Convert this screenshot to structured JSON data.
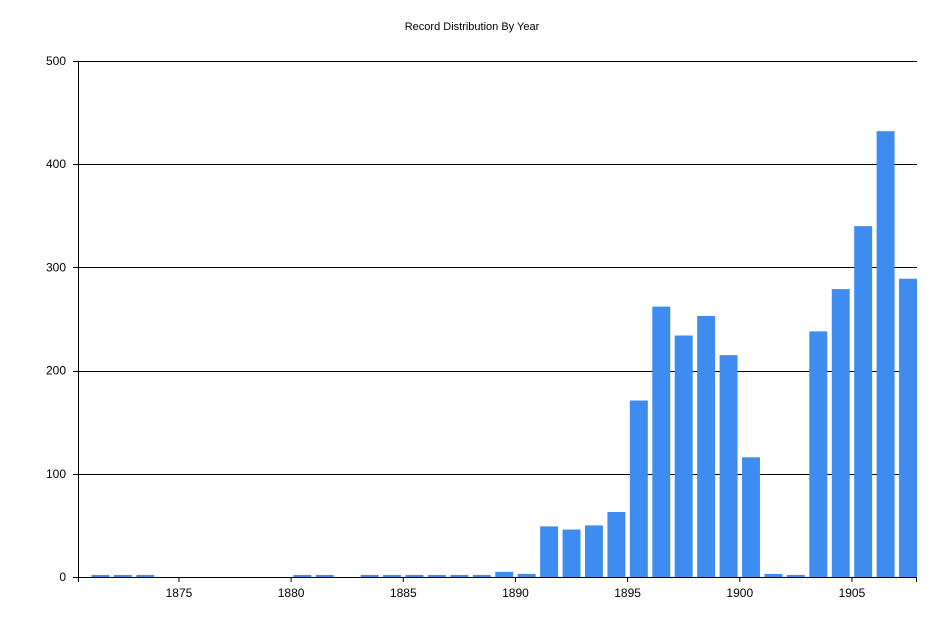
{
  "colors": {
    "bar": "#3f8cf0",
    "gridline": "#000000",
    "axis": "#000000",
    "text": "#000000",
    "background": "#ffffff"
  },
  "chart_data": {
    "type": "bar",
    "title": "Record Distribution By Year",
    "xlabel": "",
    "ylabel": "",
    "xlim": [
      1870.5,
      1907.9
    ],
    "ylim": [
      0,
      500
    ],
    "grid": true,
    "legend": "none",
    "yticks": [
      0,
      100,
      200,
      300,
      400,
      500
    ],
    "xticks": [
      1875,
      1880,
      1885,
      1890,
      1895,
      1900,
      1905
    ],
    "x": [
      1872,
      1873,
      1874,
      1881,
      1882,
      1884,
      1885,
      1886,
      1887,
      1888,
      1889,
      1890,
      1891,
      1892,
      1893,
      1894,
      1895,
      1896,
      1897,
      1898,
      1899,
      1900,
      1901,
      1902,
      1903,
      1904,
      1905,
      1906,
      1907,
      1908
    ],
    "values": [
      2,
      2,
      2,
      2,
      2,
      2,
      2,
      2,
      2,
      2,
      2,
      5,
      3,
      49,
      46,
      50,
      63,
      171,
      262,
      234,
      253,
      215,
      116,
      3,
      2,
      238,
      279,
      340,
      432,
      289
    ]
  }
}
